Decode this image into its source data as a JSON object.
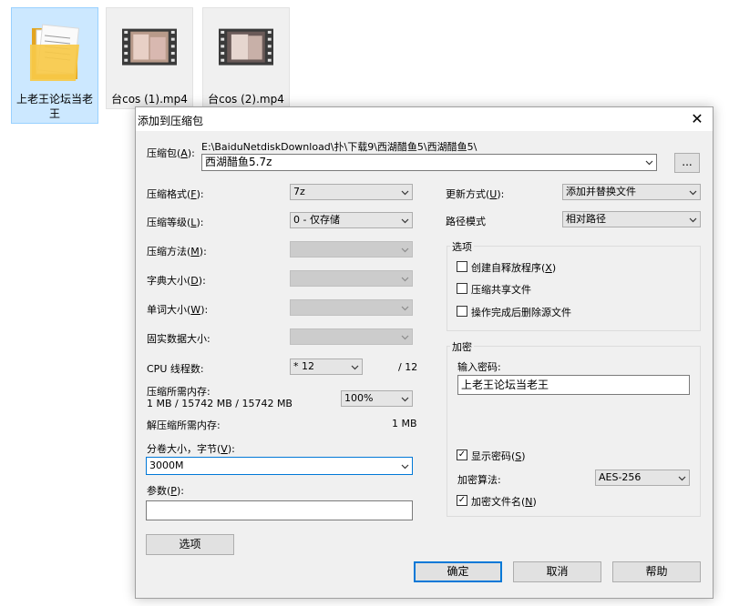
{
  "desktop": {
    "files": [
      {
        "name": "上老王论坛当老王",
        "type": "folder"
      },
      {
        "name": "台cos (1).mp4",
        "type": "video"
      },
      {
        "name": "台cos (2).mp4",
        "type": "video"
      }
    ]
  },
  "dialog": {
    "title": "添加到压缩包",
    "close_glyph": "✕",
    "archive": {
      "label": "压缩包(",
      "label_key": "A",
      "label_end": "):",
      "path": "E:\\BaiduNetdiskDownload\\扑\\下载9\\西湖醋鱼5\\西湖醋鱼5\\",
      "filename": "西湖醋鱼5.7z",
      "browse_label": "..."
    },
    "left": {
      "format": {
        "label": "压缩格式(",
        "key": "F",
        "end": "):",
        "value": "7z"
      },
      "level": {
        "label": "压缩等级(",
        "key": "L",
        "end": "):",
        "value": "0 - 仅存储"
      },
      "method": {
        "label": "压缩方法(",
        "key": "M",
        "end": "):"
      },
      "dict": {
        "label": "字典大小(",
        "key": "D",
        "end": "):"
      },
      "word": {
        "label": "单词大小(",
        "key": "W",
        "end": "):"
      },
      "solid": {
        "label": "固实数据大小:"
      },
      "cpu": {
        "label": "CPU 线程数:",
        "value": "* 12",
        "total": "/ 12"
      },
      "mem_compress": {
        "label": "压缩所需内存:",
        "detail": "1 MB / 15742 MB / 15742 MB",
        "value": "100%"
      },
      "mem_decompress": {
        "label": "解压缩所需内存:",
        "value": "1 MB"
      },
      "volume": {
        "label": "分卷大小，字节(",
        "key": "V",
        "end": "):",
        "value": "3000M"
      },
      "params": {
        "label": "参数(",
        "key": "P",
        "end": "):",
        "value": ""
      },
      "options_button": "选项"
    },
    "right": {
      "update": {
        "label": "更新方式(",
        "key": "U",
        "end": "):",
        "value": "添加并替换文件"
      },
      "path_mode": {
        "label": "路径模式",
        "value": "相对路径"
      },
      "options_group": {
        "title": "选项",
        "items": [
          {
            "label": "创建自释放程序(",
            "key": "X",
            "end": ")",
            "checked": false
          },
          {
            "label": "压缩共享文件",
            "checked": false
          },
          {
            "label": "操作完成后删除源文件",
            "checked": false
          }
        ]
      },
      "encryption": {
        "title": "加密",
        "password_label": "输入密码:",
        "password_value": "上老王论坛当老王",
        "show_password": {
          "label": "显示密码(",
          "key": "S",
          "end": ")",
          "checked": true
        },
        "algorithm_label": "加密算法:",
        "algorithm_value": "AES-256",
        "encrypt_names": {
          "label": "加密文件名(",
          "key": "N",
          "end": ")",
          "checked": true
        }
      }
    },
    "buttons": {
      "ok": "确定",
      "cancel": "取消",
      "help": "帮助"
    }
  },
  "colors": {
    "accent": "#0078d7",
    "folder": "#f7c948",
    "selection": "#cce8ff"
  }
}
